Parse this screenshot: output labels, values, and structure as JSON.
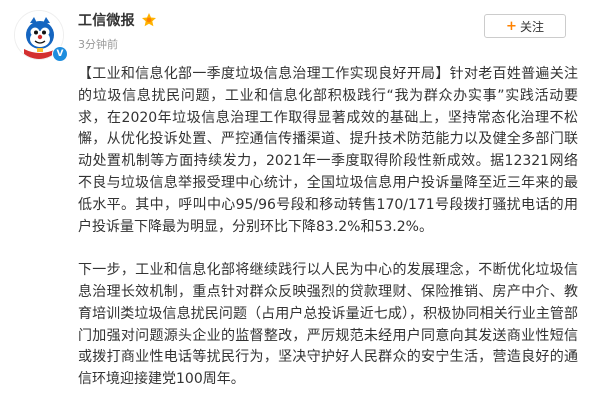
{
  "user": {
    "name": "工信微报",
    "verified_mark": "V",
    "avatar_icon": "mascot-avatar-icon",
    "vip_icon": "vip-badge-icon"
  },
  "post": {
    "timestamp": "3分钟前",
    "follow_label": "关注",
    "follow_plus": "+",
    "paragraphs": [
      "【工业和信息化部一季度垃圾信息治理工作实现良好开局】针对老百姓普遍关注的垃圾信息扰民问题，工业和信息化部积极践行“我为群众办实事”实践活动要求，在2020年垃圾信息治理工作取得显著成效的基础上，坚持常态化治理不松懈，从优化投诉处置、严控通信传播渠道、提升技术防范能力以及健全多部门联动处置机制等方面持续发力，2021年一季度取得阶段性新成效。据12321网络不良与垃圾信息举报受理中心统计，全国垃圾信息用户投诉量降至近三年来的最低水平。其中，呼叫中心95/96号段和移动转售170/171号段拨打骚扰电话的用户投诉量下降最为明显，分别环比下降83.2%和53.2%。",
      "下一步，工业和信息化部将继续践行以人民为中心的发展理念，不断优化垃圾信息治理长效机制，重点针对群众反映强烈的贷款理财、保险推销、房产中介、教育培训类垃圾信息扰民问题（占用户总投诉量近七成），积极协同相关行业主管部门加强对问题源头企业的监督整改，严厉规范未经用户同意向其发送商业性短信或拨打商业性电话等扰民行为，坚决守护好人民群众的安宁生活，营造良好的通信环境迎接建党100周年。"
    ]
  },
  "colors": {
    "accent": "#ff8200",
    "verified_blue": "#1e8dde",
    "text": "#333333",
    "muted": "#999999"
  }
}
